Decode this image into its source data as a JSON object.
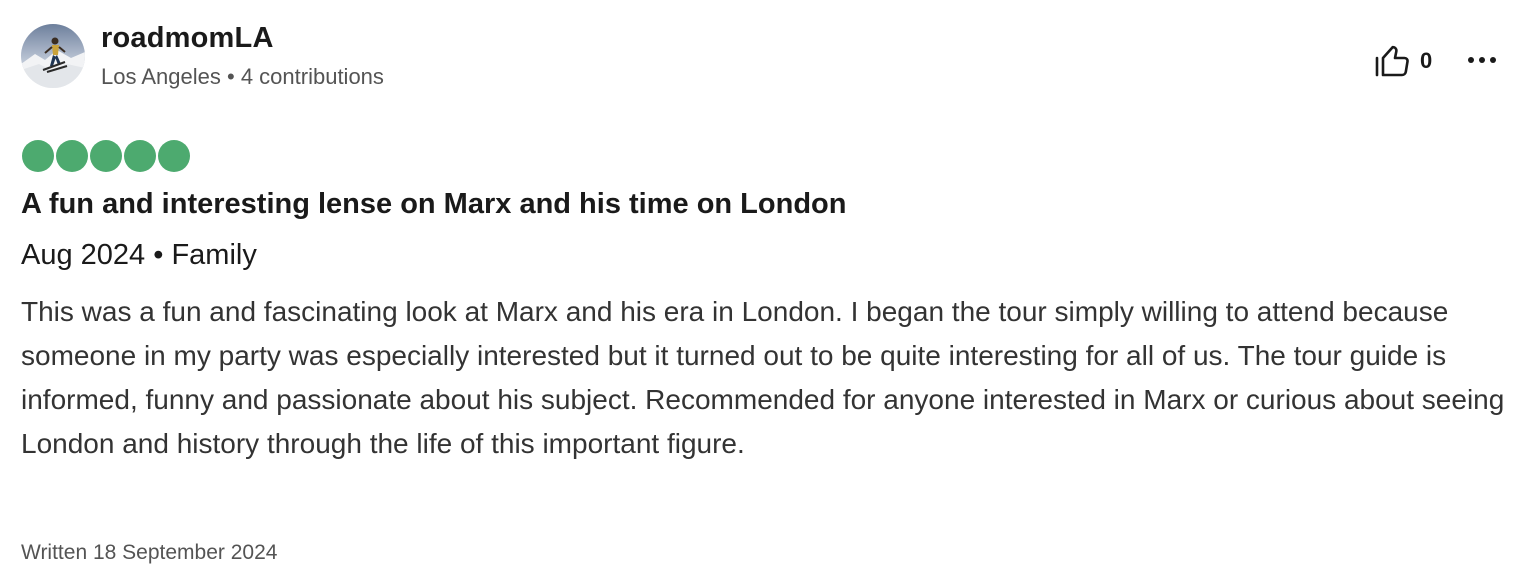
{
  "reviewer": {
    "name": "roadmomLA",
    "location": "Los Angeles",
    "separator": "•",
    "contributions": "4 contributions",
    "avatar_icon": "skier-avatar"
  },
  "actions": {
    "helpful_icon": "thumbs-up-icon",
    "helpful_count": "0",
    "more_icon": "more-options-icon"
  },
  "rating": {
    "value": 5,
    "max": 5,
    "color": "#4daa6f"
  },
  "review": {
    "title": "A fun and interesting lense on Marx and his time on London",
    "trip_date": "Aug 2024",
    "trip_separator": "•",
    "trip_type": "Family",
    "body": "This was a fun and fascinating look at Marx and his era in London. I began the tour simply willing to attend because someone in my party was especially interested but it turned out to be quite interesting for all of us. The tour guide is informed, funny and passionate about his subject. Recommended for anyone interested in Marx or curious about seeing London and history through the life of this important figure.",
    "written": "Written 18 September 2024"
  }
}
